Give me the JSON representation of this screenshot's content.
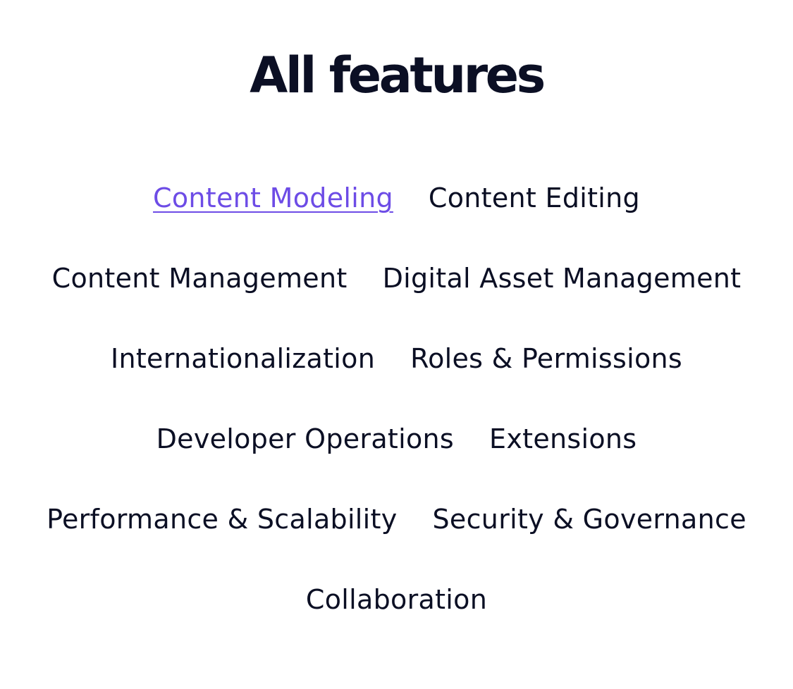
{
  "page": {
    "title": "All features"
  },
  "colors": {
    "text": "#0b0f24",
    "accent": "#6d4ce6",
    "background": "#ffffff"
  },
  "features": {
    "active_index": 0,
    "rows": [
      [
        "Content Modeling",
        "Content Editing"
      ],
      [
        "Content Management",
        "Digital Asset Management"
      ],
      [
        "Internationalization",
        "Roles & Permissions"
      ],
      [
        "Developer Operations",
        "Extensions"
      ],
      [
        "Performance & Scalability",
        "Security & Governance"
      ],
      [
        "Collaboration"
      ]
    ]
  }
}
